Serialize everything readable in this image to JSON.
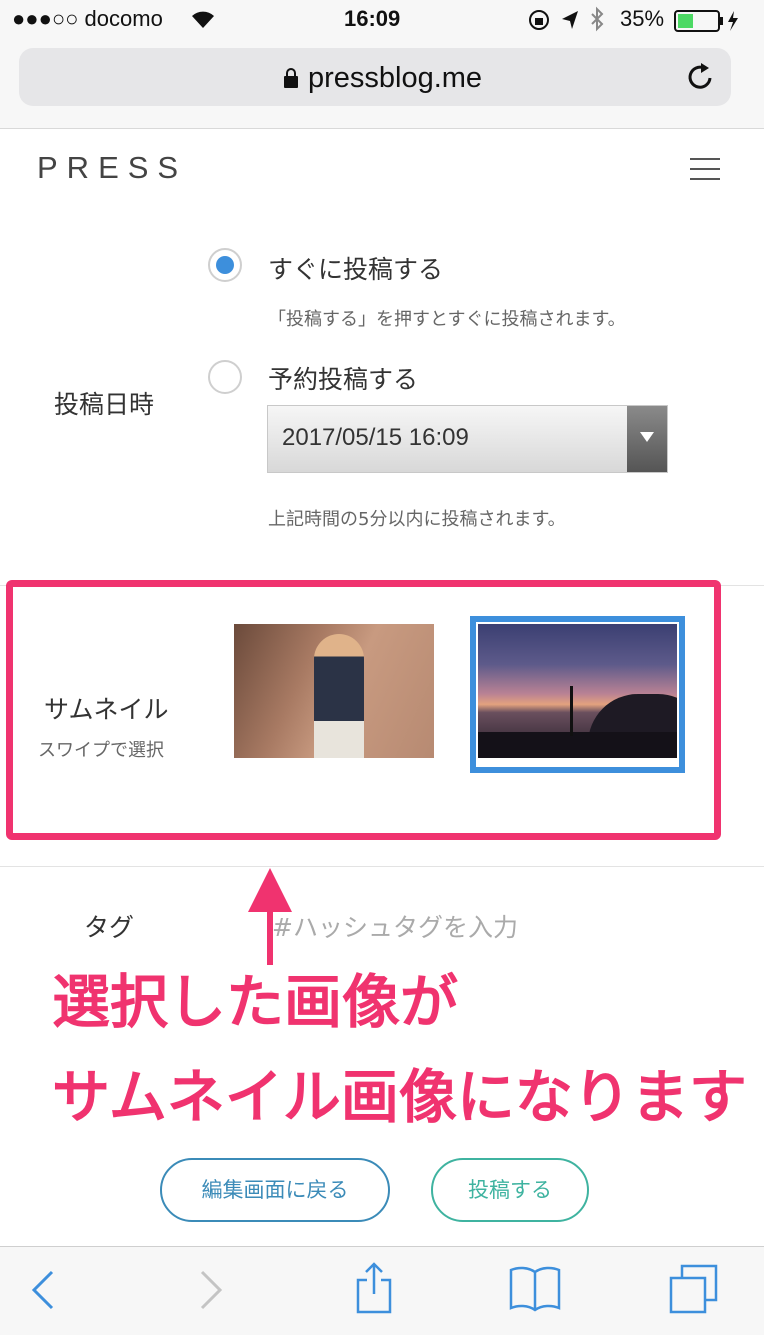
{
  "status_bar": {
    "carrier": "●●●○○ docomo",
    "time": "16:09",
    "battery": "35%"
  },
  "browser": {
    "url": "pressblog.me"
  },
  "header": {
    "logo": "PRESS"
  },
  "post_date": {
    "label": "投稿日時",
    "option_now": "すぐに投稿する",
    "option_now_note": "「投稿する」を押すとすぐに投稿されます。",
    "option_now_selected": true,
    "option_scheduled": "予約投稿する",
    "datetime_value": "2017/05/15 16:09",
    "scheduled_note": "上記時間の5分以内に投稿されます。"
  },
  "thumbnail": {
    "label": "サムネイル",
    "sublabel": "スワイプで選択"
  },
  "tags": {
    "label": "タグ",
    "placeholder": "#ハッシュタグを入力"
  },
  "annotation": {
    "line1": "選択した画像が",
    "line2": "サムネイル画像になります",
    "color": "#f0336f"
  },
  "actions": {
    "back_label": "編集画面に戻る",
    "post_label": "投稿する",
    "back_color": "#3b8bb8",
    "post_color": "#3fb3a0"
  }
}
